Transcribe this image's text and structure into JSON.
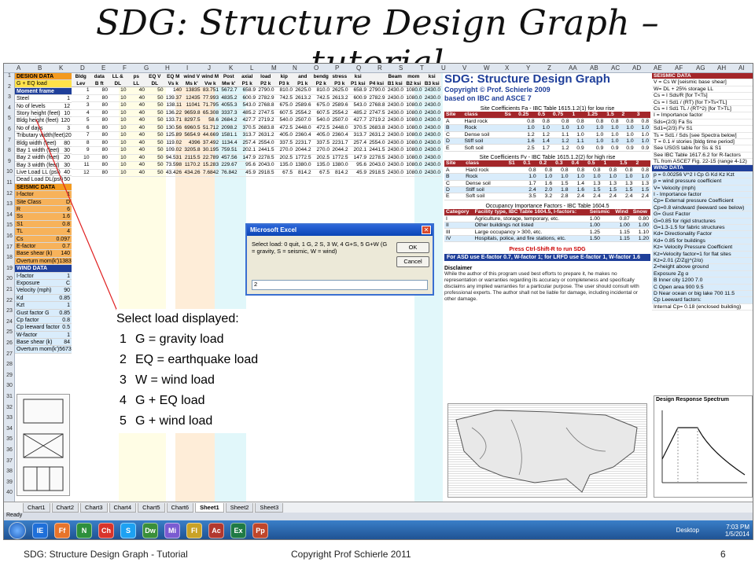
{
  "slide": {
    "title": "SDG: Structure Design Graph – tutorial",
    "footer_left": "SDG: Structure Design Graph - Tutorial",
    "footer_center": "Copyright Prof Schierle 2011",
    "page_number": "6"
  },
  "excel": {
    "columns": [
      "A",
      "B",
      "K",
      "D",
      "E",
      "F",
      "G",
      "H",
      "I",
      "J",
      "K",
      "L",
      "M",
      "N",
      "O",
      "P",
      "Q",
      "R",
      "S",
      "T",
      "U",
      "V",
      "W",
      "X",
      "Y",
      "Z",
      "AA",
      "AB",
      "AC",
      "AD",
      "AE",
      "AF",
      "AG",
      "AH",
      "AI"
    ],
    "left": {
      "design_data": "DESIGN DATA",
      "selected": "G + EQ load",
      "moment": "Moment frame",
      "rows": [
        [
          "Steel",
          "1"
        ],
        [
          "No of levels",
          "12"
        ],
        [
          "Story height (feet)",
          "10"
        ],
        [
          "Bldg height (feet)",
          "120"
        ],
        [
          "No of days",
          "3"
        ],
        [
          "Tributary width(feet)",
          "20"
        ],
        [
          "Bldg width (feet)",
          "80"
        ],
        [
          "Bay 1 width (feet)",
          "30"
        ],
        [
          "Bay 2 width (feet)",
          "20"
        ],
        [
          "Bay 3 width (feet)",
          "30"
        ],
        [
          "Live Load LL (psf)",
          "40"
        ],
        [
          "Dead Load DL(psf)",
          "50"
        ]
      ],
      "seismic": "SEISMIC DATA",
      "seismic_rows": [
        [
          "I-factor",
          "1"
        ],
        [
          "Site Class",
          "D"
        ],
        [
          "R",
          "6"
        ],
        [
          "Ss",
          "1.6"
        ],
        [
          "S1",
          "0.8"
        ],
        [
          "TL",
          "4"
        ],
        [
          "Cs",
          "0.097"
        ],
        [
          "E-factor",
          "0.7"
        ]
      ],
      "base_shear": [
        "Base shear (k)",
        "140"
      ],
      "overturn": [
        "Overturn mom(k')",
        "13835"
      ],
      "wind": "WIND DATA",
      "wind_rows": [
        [
          "I-factor",
          "1"
        ],
        [
          "Exposure",
          "C"
        ],
        [
          "Velocity (mph)",
          "90"
        ],
        [
          "Kd",
          "0.85"
        ],
        [
          "Kzt",
          "1"
        ],
        [
          "Gust factor G",
          "0.85"
        ],
        [
          "Cp factor",
          "0.8"
        ],
        [
          "Cp leeward factor",
          "0.5"
        ],
        [
          "W-factor",
          "1"
        ]
      ],
      "wind_base": [
        "Base shear (k)",
        "84"
      ],
      "wind_overturn": [
        "Overturn mom(k')",
        "5673"
      ]
    },
    "grid": {
      "headers": [
        "Lev",
        "B ft",
        "H ft",
        "LL",
        "DL",
        "Vs k",
        "Ms k'",
        "Vw k",
        "Mw k'",
        "P1 k",
        "P2 k",
        "P3 k",
        "P1 k",
        "P2 k",
        "P3 k",
        "P1 ksi",
        "P4 ksi",
        "B1 ksi",
        "B2 ksi",
        "B3 ksi"
      ],
      "top": [
        "Bldg",
        "data",
        "LL & DL",
        "ps",
        "EQ V",
        "EQ M",
        "wind V",
        "wind M",
        "Post",
        "axial",
        "load",
        "kip",
        "and",
        "bendg",
        "stress",
        "ksi",
        "",
        "Beam",
        "mom",
        "ksi"
      ],
      "rows": [
        [
          "1",
          "80",
          "10",
          "40",
          "50",
          "140",
          "13835",
          "83.751",
          "5672.7",
          "658.9",
          "2790.0",
          "810.0",
          "2625.0",
          "810.0",
          "2625.0",
          "658.9",
          "2790.0",
          "2430.0",
          "1080.0",
          "2430.0"
        ],
        [
          "2",
          "80",
          "10",
          "40",
          "50",
          "139.37",
          "12435",
          "77.993",
          "4835.2",
          "600.9",
          "2782.9",
          "742.5",
          "2613.2",
          "742.5",
          "2613.2",
          "600.9",
          "2782.9",
          "2430.0",
          "1080.0",
          "2430.0"
        ],
        [
          "3",
          "80",
          "10",
          "40",
          "50",
          "138.11",
          "11041",
          "71.795",
          "4055.3",
          "543.0",
          "2768.8",
          "675.0",
          "2589.6",
          "675.0",
          "2589.6",
          "543.0",
          "2768.8",
          "2430.0",
          "1080.0",
          "2430.0"
        ],
        [
          "4",
          "80",
          "10",
          "40",
          "50",
          "136.22",
          "9659.8",
          "65.308",
          "3337.3",
          "485.2",
          "2747.5",
          "607.5",
          "2554.2",
          "607.5",
          "2554.2",
          "485.2",
          "2747.5",
          "2430.0",
          "1080.0",
          "2430.0"
        ],
        [
          "5",
          "80",
          "10",
          "40",
          "50",
          "133.71",
          "8297.5",
          "58.6",
          "2684.2",
          "427.7",
          "2719.2",
          "540.0",
          "2507.0",
          "540.0",
          "2507.0",
          "427.7",
          "2719.2",
          "2430.0",
          "1080.0",
          "2430.0"
        ],
        [
          "6",
          "80",
          "10",
          "40",
          "50",
          "130.56",
          "6960.5",
          "51.712",
          "2098.2",
          "370.5",
          "2683.8",
          "472.5",
          "2448.0",
          "472.5",
          "2448.0",
          "370.5",
          "2683.8",
          "2430.0",
          "1080.0",
          "2430.0"
        ],
        [
          "7",
          "80",
          "10",
          "40",
          "50",
          "125.89",
          "5654.9",
          "44.669",
          "1581.1",
          "313.7",
          "2631.2",
          "405.0",
          "2360.4",
          "405.0",
          "2360.4",
          "313.7",
          "2631.2",
          "2430.0",
          "1080.0",
          "2430.0"
        ],
        [
          "8",
          "80",
          "10",
          "40",
          "50",
          "119.02",
          "4396",
          "37.492",
          "1134.4",
          "257.4",
          "2554.0",
          "337.5",
          "2231.7",
          "337.5",
          "2231.7",
          "257.4",
          "2554.0",
          "2430.0",
          "1080.0",
          "2430.0"
        ],
        [
          "9",
          "80",
          "10",
          "40",
          "50",
          "109.02",
          "3205.8",
          "30.195",
          "759.51",
          "202.1",
          "2441.5",
          "270.0",
          "2044.2",
          "270.0",
          "2044.2",
          "202.1",
          "2441.5",
          "2430.0",
          "1080.0",
          "2430.0"
        ],
        [
          "10",
          "80",
          "10",
          "40",
          "50",
          "94.531",
          "2115.5",
          "22.789",
          "457.56",
          "147.9",
          "2278.5",
          "202.5",
          "1772.5",
          "202.5",
          "1772.5",
          "147.9",
          "2278.5",
          "2430.0",
          "1080.0",
          "2430.0"
        ],
        [
          "11",
          "80",
          "10",
          "40",
          "50",
          "73.598",
          "1170.2",
          "15.283",
          "229.67",
          "95.6",
          "2043.0",
          "135.0",
          "1380.0",
          "135.0",
          "1380.0",
          "95.6",
          "2043.0",
          "2430.0",
          "1080.0",
          "2430.0"
        ],
        [
          "12",
          "80",
          "10",
          "40",
          "50",
          "43.426",
          "434.26",
          "7.6842",
          "76.842",
          "45.9",
          "2918.5",
          "67.5",
          "814.2",
          "67.5",
          "814.2",
          "45.9",
          "2918.5",
          "2430.0",
          "1080.0",
          "2430.0"
        ]
      ]
    },
    "info": {
      "app_name": "SDG: Structure Design Graph",
      "copyright": "Copyright © Prof. Schierle 2009",
      "basis": "based on IBC and ASCE 7",
      "fa_title": "Site Coefficients Fa - IBC Table 1615.1.2(1) for low rise",
      "fa_head": [
        "Site",
        "class",
        "Ss",
        "0.25",
        "0.5",
        "0.75",
        "1",
        "1.25",
        "1.5",
        "2",
        "3"
      ],
      "fa_rows": [
        [
          "A",
          "Hard rock",
          "",
          "0.8",
          "0.8",
          "0.8",
          "0.8",
          "0.8",
          "0.8",
          "0.8",
          "0.8"
        ],
        [
          "B",
          "Rock",
          "",
          "1.0",
          "1.0",
          "1.0",
          "1.0",
          "1.0",
          "1.0",
          "1.0",
          "1.0"
        ],
        [
          "C",
          "Dense soil",
          "",
          "1.2",
          "1.2",
          "1.1",
          "1.0",
          "1.0",
          "1.0",
          "1.0",
          "1.0"
        ],
        [
          "D",
          "Stiff soil",
          "",
          "1.6",
          "1.4",
          "1.2",
          "1.1",
          "1.0",
          "1.0",
          "1.0",
          "1.0"
        ],
        [
          "E",
          "Soft soil",
          "",
          "2.5",
          "1.7",
          "1.2",
          "0.9",
          "0.9",
          "0.9",
          "0.9",
          "0.9"
        ]
      ],
      "fv_title": "Site Coefficients Fv - IBC Table 1615.1.2(2) for high rise",
      "fv_head": [
        "Site",
        "class",
        "S1",
        "0.1",
        "0.2",
        "0.3",
        "0.4",
        "0.5",
        "1",
        "1.5",
        "2"
      ],
      "fv_rows": [
        [
          "A",
          "Hard rock",
          "",
          "0.8",
          "0.8",
          "0.8",
          "0.8",
          "0.8",
          "0.8",
          "0.8",
          "0.8"
        ],
        [
          "B",
          "Rock",
          "",
          "1.0",
          "1.0",
          "1.0",
          "1.0",
          "1.0",
          "1.0",
          "1.0",
          "1.0"
        ],
        [
          "C",
          "Dense soil",
          "",
          "1.7",
          "1.6",
          "1.5",
          "1.4",
          "1.3",
          "1.3",
          "1.3",
          "1.3"
        ],
        [
          "D",
          "Stiff soil",
          "",
          "2.4",
          "2.0",
          "1.8",
          "1.6",
          "1.5",
          "1.5",
          "1.5",
          "1.5"
        ],
        [
          "E",
          "Soft soil",
          "",
          "3.5",
          "3.2",
          "2.8",
          "2.4",
          "2.4",
          "2.4",
          "2.4",
          "2.4"
        ]
      ],
      "occ_title": "Occupancy Importance Factors - IBC Table 1604.5",
      "occ_head": [
        "Category",
        "Facility type, IBC Table 1604.5, I-factors:",
        "Seismic",
        "Wind",
        "Snow"
      ],
      "occ_rows": [
        [
          "I",
          "Agriculture, storage, temporary, etc.",
          "1.00",
          "0.87",
          "0.80"
        ],
        [
          "II",
          "Other buildings not listed",
          "1.00",
          "1.00",
          "1.00"
        ],
        [
          "III",
          "Large occupancy > 300, etc.",
          "1.25",
          "1.15",
          "1.10"
        ],
        [
          "IV",
          "Hospitals, police, and fire stations, etc.",
          "1.50",
          "1.15",
          "1.20"
        ]
      ],
      "press": "Press Ctrl-Shift-R to run SDG",
      "asd": "For ASD use E-factor 0.7, W-factor 1; for LRFD use E-factor 1, W-factor 1.6",
      "disclaimer_title": "Disclaimer",
      "disclaimer": "While the author of this program used best efforts to prepare it, he makes no representation or warranties regarding its accuracy or completeness and specifically disclaims any implied warranties for a particular purpose. The user should consult with professional experts. The author shall not be liable for damage, including incidental or other damage."
    },
    "right": {
      "seismic": "SEISMIC DATA",
      "rows": [
        "V = Cs W    [seismic base shear]",
        "W= DL + 25% storage LL",
        "Cs = I Sds/R            [for T<Ts]",
        "Cs = I Sd1 / (RT)         [for T>Ts<TL]",
        "Cs = I Sd1 TL / (RT^2)   [for T>TL]",
        "I = Importance factor",
        "Sds=(2/3) Fa Ss",
        "Sd1=(2/3) Fv S1",
        "Ts = Sd1 / Sds  [see Spectra below]",
        "T = 0.1 # stories  [bldg time period]",
        "See USGS table for Ss & S1",
        "See IBC Table 1617.6.2 for R-factors",
        "TL from ASCE7 Fig. 22-15 (range 4-12)"
      ],
      "wind": "WIND DATA",
      "wind_rows": [
        "p = 0.00256 V^2 I Cp G Kd Kz Kzt",
        "p = wind pressure coefficient",
        "V= Velocity (mph)",
        "I - Importance factor",
        "Cp= External pressure Coefficient",
        "Cp=0.8 windward (leeward see below)",
        "G= Gust Factor",
        "G=0.85 for rigid structures",
        "G=1.3-1.5 for fabric structures",
        "Kd= Directionality Factor",
        "Kd= 0.85 for buildings",
        "Kz= Velocity Pressure Coefficient",
        "Kz=Velocity factor=1 for flat sites",
        "Kz=2.01 (Z/Zg)^(2/α)",
        "Z=height above ground",
        "Exposure      Zg       α",
        "B  Inner city        1200    7.0",
        "C  Open area          900    9.5",
        "D  Near ocean or big lake   700   11.5",
        "Cp   Leeward factors:"
      ],
      "internal": "Internal Cp= 0.18 (enclosed building)",
      "spectrum": "Design Response Spectrum"
    },
    "tabs": [
      "Chart1",
      "Chart2",
      "Chart3",
      "Chart4",
      "Chart5",
      "Chart6",
      "Sheet1",
      "Sheet2",
      "Sheet3"
    ],
    "active_tab": "Sheet1",
    "status": "Ready",
    "tray": {
      "desktop": "Desktop",
      "time": "7:03 PM",
      "date": "1/5/2014"
    },
    "taskbar_icons": [
      "IE",
      "Ff",
      "N",
      "Ch",
      "S",
      "Dw",
      "Mi",
      "Fl",
      "Ac",
      "Ex",
      "Pp"
    ]
  },
  "dialog": {
    "title": "Microsoft Excel",
    "message": "Select load: 0 quit, 1 G, 2 S, 3 W, 4 G+S, 5 G+W (G = gravity, S = seismic, W = wind)",
    "ok": "OK",
    "cancel": "Cancel",
    "value": "2",
    "close": "✕"
  },
  "callout": {
    "heading": "Select load displayed:",
    "items": [
      {
        "n": "1",
        "t": "G = gravity load"
      },
      {
        "n": "2",
        "t": "EQ = earthquake load"
      },
      {
        "n": "3",
        "t": "W = wind load"
      },
      {
        "n": "4",
        "t": "G + EQ load"
      },
      {
        "n": "5",
        "t": "G + wind load"
      }
    ]
  }
}
